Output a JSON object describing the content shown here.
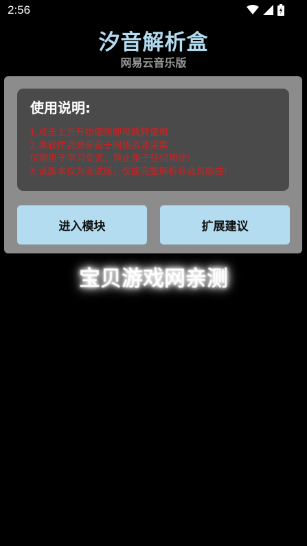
{
  "status_bar": {
    "time": "2:56",
    "icons": [
      "wifi-icon",
      "signal-icon",
      "battery-icon"
    ]
  },
  "header": {
    "title": "汐音解析盒",
    "subtitle": "网易云音乐版"
  },
  "instructions": {
    "title": "使用说明:",
    "lines": [
      "1.点击上方开始使用即可跳转使用",
      "2.本软件资源来自于网络资源采集",
      "仅限用于学习交流，禁止用于任何用途!",
      "3.该版本仅为测试版，仅能完整解析非会员歌曲!"
    ]
  },
  "buttons": {
    "enter_label": "进入模块",
    "suggest_label": "扩展建议"
  },
  "watermark": {
    "text": "宝贝游戏网亲测"
  },
  "colors": {
    "accent": "#b3dcf0",
    "panel": "#8c8c8c",
    "card": "#4a4a4a",
    "warning_text": "#d42020",
    "background": "#000000"
  }
}
